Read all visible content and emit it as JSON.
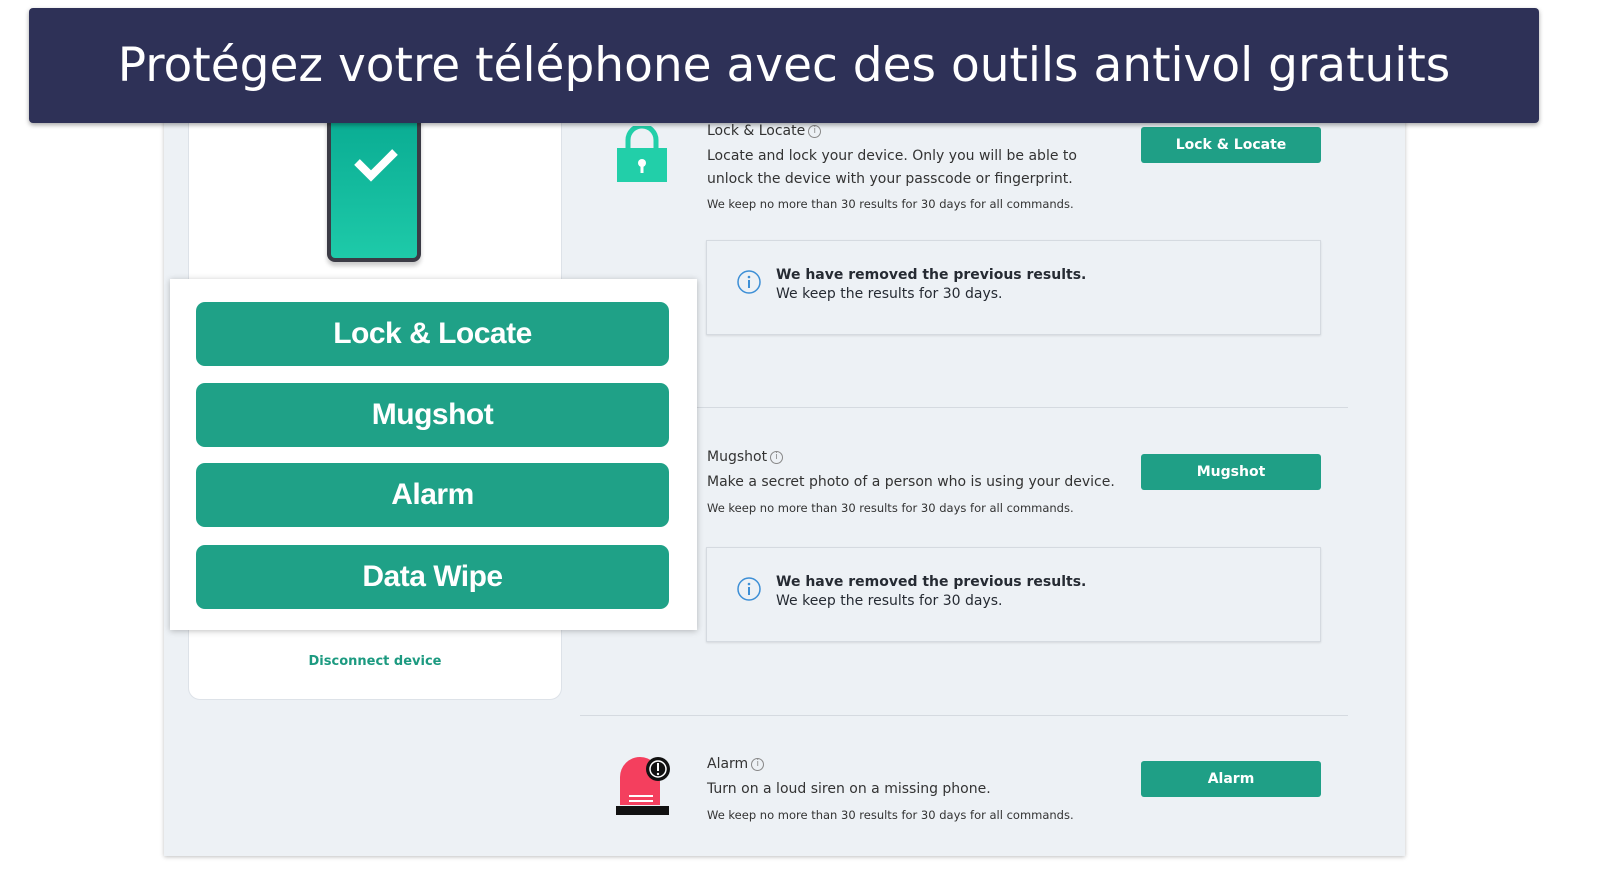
{
  "banner": {
    "title": "Protégez votre téléphone avec des outils antivol gratuits"
  },
  "popup": {
    "buttons": [
      "Lock & Locate",
      "Mugshot",
      "Alarm",
      "Data Wipe"
    ]
  },
  "left": {
    "disconnect": "Disconnect device"
  },
  "features": [
    {
      "title": "Lock & Locate",
      "desc": "Locate and lock your device. Only you will be able to unlock the device with your passcode or fingerprint.",
      "note": "We keep no more than 30 results for 30 days for all commands.",
      "button": "Lock & Locate",
      "info_bold": "We have removed the previous results.",
      "info_text": "We keep the results for 30 days."
    },
    {
      "title": "Mugshot",
      "desc": "Make a secret photo of a person who is using your device.",
      "note": "We keep no more than 30 results for 30 days for all commands.",
      "button": "Mugshot",
      "info_bold": "We have removed the previous results.",
      "info_text": "We keep the results for 30 days."
    },
    {
      "title": "Alarm",
      "desc": "Turn on a loud siren on a missing phone.",
      "note": "We keep no more than 30 results for 30 days for all commands.",
      "button": "Alarm"
    }
  ],
  "colors": {
    "accent": "#1fa187",
    "banner": "#2e3157",
    "alarm": "#f43f5e"
  }
}
